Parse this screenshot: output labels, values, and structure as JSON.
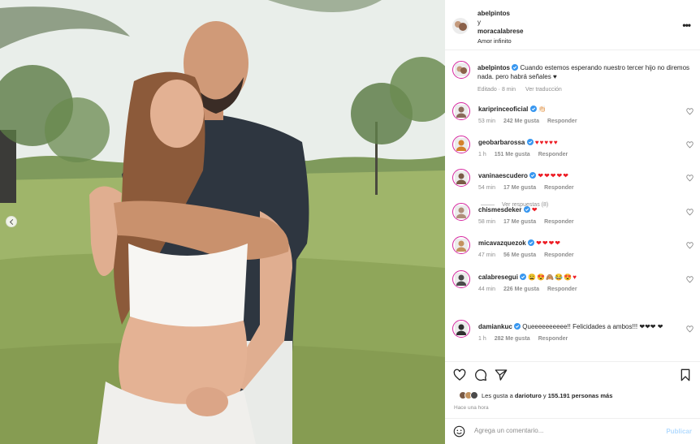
{
  "post_header": {
    "author": "abelpintos",
    "conjunction": "y",
    "coauthor": "moracalabrese",
    "audio": "Amor infinito",
    "more_icon": "more-horizontal-icon"
  },
  "caption": {
    "username": "abelpintos",
    "text": "Cuando estemos esperando nuestro tercer hijo no diremos nada. pero habrá señales ♥",
    "edited": "Editado · 8 min",
    "translate": "Ver traducción"
  },
  "comments": [
    {
      "username": "kariprinceoficial",
      "text": "👏🏻",
      "time": "53 min",
      "likes": "242 Me gusta",
      "reply": "Responder",
      "avatar_color": "#8a6a5a"
    },
    {
      "username": "geobarbarossa",
      "text": "♥♥♥♥♥",
      "time": "1 h",
      "likes": "151 Me gusta",
      "reply": "Responder",
      "avatar_color": "#d4822b"
    },
    {
      "username": "vaninaescudero",
      "text": "❤❤❤❤❤",
      "time": "54 min",
      "likes": "17 Me gusta",
      "reply": "Responder",
      "avatar_color": "#7a5b46"
    },
    {
      "username": "chismesdeker",
      "text": "❤",
      "time": "58 min",
      "likes": "17 Me gusta",
      "reply": "Responder",
      "avatar_color": "#b08f7a"
    },
    {
      "username": "micavazquezok",
      "text": "❤❤❤❤",
      "time": "47 min",
      "likes": "56 Me gusta",
      "reply": "Responder",
      "avatar_color": "#c3925e"
    },
    {
      "username": "calabresegui",
      "text": "😩😍🙈😂😍♥",
      "time": "44 min",
      "likes": "226 Me gusta",
      "reply": "Responder",
      "avatar_color": "#4a4a4a"
    },
    {
      "username": "damiankuc",
      "text": "Queeeeeeeeee!! Felicidades a ambos!!! ❤❤❤ ❤",
      "time": "1 h",
      "likes": "282 Me gusta",
      "reply": "Responder",
      "avatar_color": "#2f2f2f"
    }
  ],
  "view_replies": "Ver respuestas (8)",
  "likes_line": {
    "prefix": "Les gusta a",
    "user": "darioturo",
    "middle": "y",
    "count": "155.191 personas más"
  },
  "time_ago": "Hace una hora",
  "add_comment": {
    "placeholder": "Agrega un comentario...",
    "publish": "Publicar"
  },
  "colors": {
    "verified": "#3897f0",
    "heart": "#ed1c24",
    "muted": "#8e8e8e",
    "ring": "#d6249f"
  }
}
